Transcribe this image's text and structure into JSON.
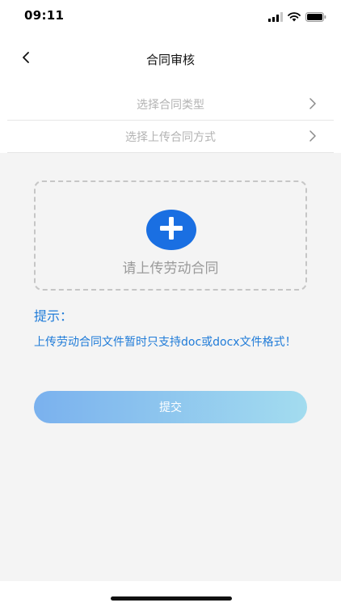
{
  "status_bar": {
    "time": "09:11"
  },
  "header": {
    "title": "合同审核"
  },
  "selectors": [
    {
      "label": "选择合同类型"
    },
    {
      "label": "选择上传合同方式"
    }
  ],
  "upload": {
    "label": "请上传劳动合同"
  },
  "hint": {
    "title": "提示：",
    "body": "上传劳动合同文件暂时只支持doc或docx文件格式！"
  },
  "actions": {
    "submit_label": "提交"
  },
  "colors": {
    "accent": "#1a6fe2",
    "hint_text": "#1f7bd8",
    "button_gradient_start": "#7ab1ee",
    "button_gradient_end": "#a3dcef",
    "background": "#f4f4f4"
  }
}
